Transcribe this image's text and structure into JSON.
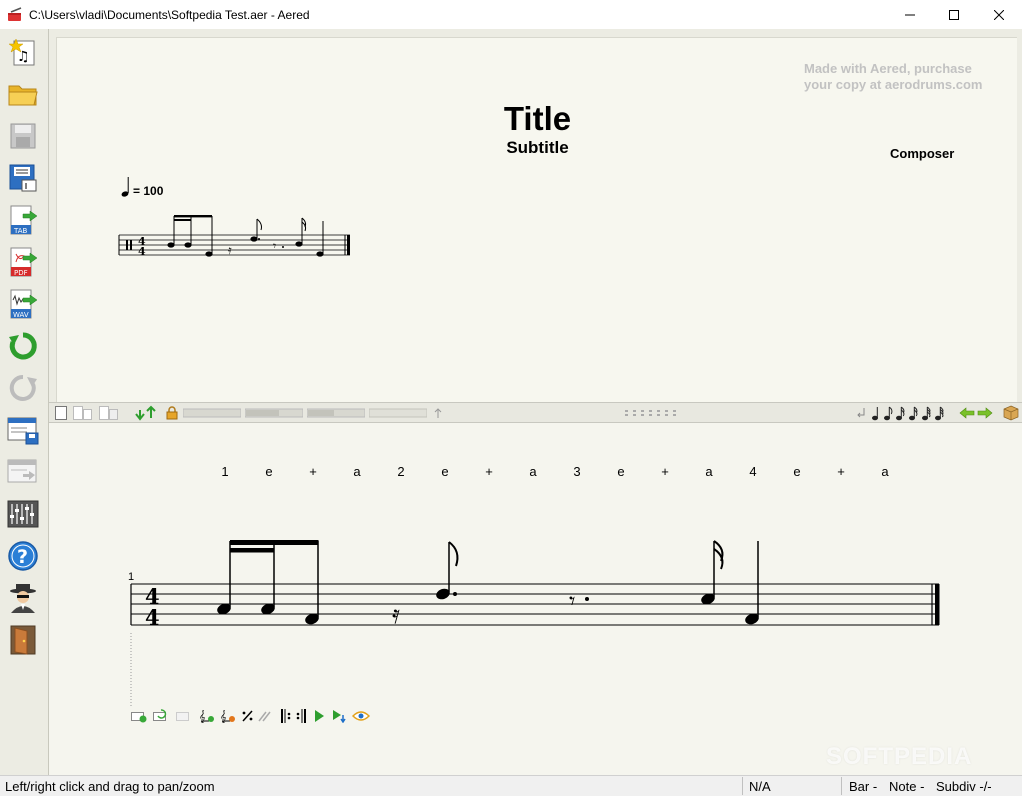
{
  "window": {
    "title": "C:\\Users\\vladi\\Documents\\Softpedia Test.aer - Aered",
    "minimize_glyph": "—",
    "maximize_glyph": "☐",
    "close_glyph": "✕"
  },
  "left_toolbar": [
    {
      "name": "new-score-icon"
    },
    {
      "name": "open-folder-icon"
    },
    {
      "name": "save-icon"
    },
    {
      "name": "save-as-icon"
    },
    {
      "name": "export-tab-icon",
      "label": "TAB"
    },
    {
      "name": "export-pdf-icon",
      "label": "PDF"
    },
    {
      "name": "export-wav-icon",
      "label": "WAV"
    },
    {
      "name": "undo-icon"
    },
    {
      "name": "redo-icon"
    },
    {
      "name": "page-save-icon"
    },
    {
      "name": "page-import-icon"
    },
    {
      "name": "mixer-icon"
    },
    {
      "name": "help-icon"
    },
    {
      "name": "user-spy-icon"
    },
    {
      "name": "exit-door-icon"
    }
  ],
  "score": {
    "watermark_line1": "Made with Aered, purchase",
    "watermark_line2": "your copy at aerodrums.com",
    "title": "Title",
    "subtitle": "Subtitle",
    "composer": "Composer",
    "tempo_value": "= 100"
  },
  "editor": {
    "counts": [
      "1",
      "e",
      "+",
      "a",
      "2",
      "e",
      "+",
      "a",
      "3",
      "e",
      "+",
      "a",
      "4",
      "e",
      "+",
      "a"
    ],
    "bar_number": "1"
  },
  "status": {
    "hint": "Left/right click and drag to pan/zoom",
    "position": "N/A",
    "bar": "Bar -",
    "note": "Note -",
    "subdiv": "Subdiv -/-"
  },
  "colors": {
    "panel_bg": "#ecece3",
    "page_bg": "#f7f7ef",
    "editor_bg": "#f5f5ee",
    "accent_green": "#2e9e2e",
    "accent_blue": "#1e6fc8"
  },
  "overlay": {
    "softpedia": "SOFTPEDIA"
  }
}
